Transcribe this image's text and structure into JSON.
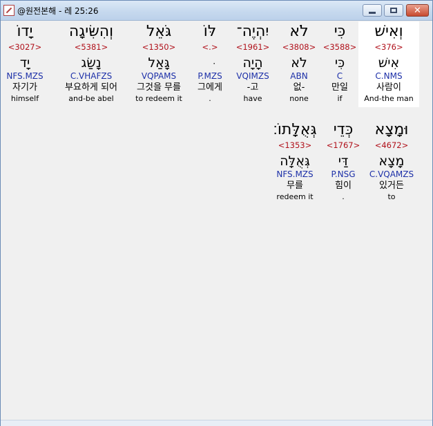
{
  "window": {
    "title": "@원전본해 - 레 25:26",
    "buttons": {
      "minimize": "minimize",
      "maximize": "maximize",
      "close": "✕"
    }
  },
  "row1": [
    {
      "heb": "וְאִישׁ",
      "strong": "<376>",
      "lemma": "אִישׁ",
      "morph": "C.NMS",
      "kor": "사람이",
      "eng": "And-the man",
      "selected": true
    },
    {
      "heb": "כִּי",
      "strong": "<3588>",
      "lemma": "כִּי",
      "morph": "C",
      "kor": "만일",
      "eng": "if"
    },
    {
      "heb": "לֹא",
      "strong": "<3808>",
      "lemma": "לֹא",
      "morph": "ABN",
      "kor": "없-",
      "eng": "none"
    },
    {
      "heb": "יִהְיֶה־",
      "strong": "<1961>",
      "lemma": "הָיָה",
      "morph": "VQIMZS",
      "kor": "-고",
      "eng": "have"
    },
    {
      "heb": "לּוֹ",
      "strong": "<.>",
      "lemma": "ּ",
      "morph": "P.MZS",
      "kor": "그에게",
      "eng": "."
    },
    {
      "heb": "גֹּאֵל",
      "strong": "<1350>",
      "lemma": "גָּאַל",
      "morph": "VQPAMS",
      "kor": "그것을 무를",
      "eng": "to redeem it"
    },
    {
      "heb": "וְהִשִּׂיגָה",
      "strong": "<5381>",
      "lemma": "נָשַׂג",
      "morph": "C.VHAFZS",
      "kor": "부요하게 되어",
      "eng": "and-be abel"
    },
    {
      "heb": "יָדוֹ",
      "strong": "<3027>",
      "lemma": "יָד",
      "morph": "NFS.MZS",
      "kor": "자기가",
      "eng": "himself"
    }
  ],
  "row2": [
    {
      "heb": "וּמָצָא",
      "strong": "<4672>",
      "lemma": "מָצָא",
      "morph": "C.VQAMZS",
      "kor": "있거든",
      "eng": "to"
    },
    {
      "heb": "כְּדֵי",
      "strong": "<1767>",
      "lemma": "דַּי",
      "morph": "P.NSG",
      "kor": "힘이",
      "eng": "."
    },
    {
      "heb": "גְּאֻלָּתוֹ׃",
      "strong": "<1353>",
      "lemma": "גְּאֻלָּה",
      "morph": "NFS.MZS",
      "kor": "무를",
      "eng": "redeem it"
    }
  ]
}
